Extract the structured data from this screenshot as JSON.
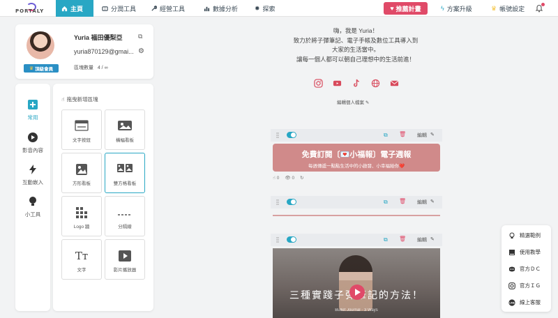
{
  "nav": {
    "brand": "PORTALY",
    "tabs": [
      {
        "label": "主頁",
        "icon": "home-icon"
      },
      {
        "label": "分潤工具",
        "icon": "ticket-icon"
      },
      {
        "label": "經營工具",
        "icon": "wrench-icon"
      },
      {
        "label": "數據分析",
        "icon": "bar-chart-icon"
      },
      {
        "label": "探索",
        "icon": "sparkle-icon"
      }
    ],
    "promo_label": "推薦計畫",
    "upgrade_label": "方案升級",
    "account_label": "帳號設定",
    "accent": "#28a7c4",
    "promo_color": "#e04a68"
  },
  "profile": {
    "name": "Yuria 福田優梨亞",
    "email": "yuria870129@gmai...",
    "badge": "頂級會員",
    "block_count_label": "區塊數量",
    "block_count_value": "4 / ∞"
  },
  "categories": [
    {
      "label": "常用",
      "icon": "plus-square-icon",
      "active": true
    },
    {
      "label": "影音內容",
      "icon": "play-circle-icon",
      "active": false
    },
    {
      "label": "互動嵌入",
      "icon": "lightning-icon",
      "active": false
    },
    {
      "label": "小工具",
      "icon": "lightbulb-icon",
      "active": false
    }
  ],
  "blocks_panel": {
    "hint": "拖曳新增區塊",
    "tiles": [
      {
        "label": "文字按鈕",
        "icon": "text-button-icon"
      },
      {
        "label": "橫幅看板",
        "icon": "image-banner-icon"
      },
      {
        "label": "方形看板",
        "icon": "square-image-icon"
      },
      {
        "label": "雙方格看板",
        "icon": "double-image-icon"
      },
      {
        "label": "Logo 牆",
        "icon": "logo-grid-icon"
      },
      {
        "label": "分隔線",
        "icon": "divider-icon"
      },
      {
        "label": "文字",
        "icon": "text-icon"
      },
      {
        "label": "影片播放器",
        "icon": "video-player-icon"
      }
    ]
  },
  "preview": {
    "intro_lines": [
      "嗨，我是 Yuria！",
      "致力於將子彈筆記、電子手帳及數位工具導入到",
      "大家的生活當中。",
      "讓每一個人都可以朝自己理想中的生活前進！"
    ],
    "social_icons": [
      "instagram-icon",
      "youtube-icon",
      "tiktok-icon",
      "globe-icon",
      "mail-icon"
    ],
    "edit_profile": "編輯個人檔案",
    "edit_label": "編輯",
    "banner_title": "免費訂閱〔💌小福報〕電子週報",
    "banner_sub": "每週傳遞一點點生活中的小啟發、小幸福給你❤️",
    "banner_color": "#d08a8a",
    "clicks": "0",
    "views": "0",
    "video_caption": "三種實踐子彈筆記的方法！",
    "video_sub": "Bullet Journal · 3 Ways"
  },
  "help_menu": [
    {
      "label": "精選範例",
      "icon": "lightbulb-icon"
    },
    {
      "label": "使用教學",
      "icon": "book-icon"
    },
    {
      "label": "官方ＤＣ",
      "icon": "discord-icon"
    },
    {
      "label": "官方ＩＧ",
      "icon": "instagram-icon"
    },
    {
      "label": "線上客服",
      "icon": "line-icon"
    }
  ]
}
